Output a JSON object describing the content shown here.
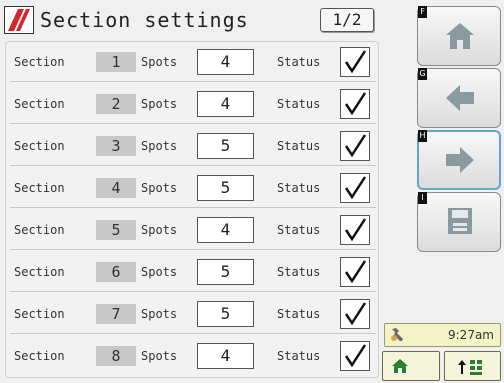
{
  "header": {
    "title": "Section settings",
    "page_indicator": "1/2"
  },
  "labels": {
    "section": "Section",
    "spots": "Spots",
    "status": "Status"
  },
  "rows": [
    {
      "section": "1",
      "spots": "4",
      "status_checked": true
    },
    {
      "section": "2",
      "spots": "4",
      "status_checked": true
    },
    {
      "section": "3",
      "spots": "5",
      "status_checked": true
    },
    {
      "section": "4",
      "spots": "5",
      "status_checked": true
    },
    {
      "section": "5",
      "spots": "4",
      "status_checked": true
    },
    {
      "section": "6",
      "spots": "5",
      "status_checked": true
    },
    {
      "section": "7",
      "spots": "5",
      "status_checked": true
    },
    {
      "section": "8",
      "spots": "4",
      "status_checked": true
    }
  ],
  "softkeys": [
    {
      "key": "F",
      "icon": "home-icon"
    },
    {
      "key": "G",
      "icon": "arrow-left-icon"
    },
    {
      "key": "H",
      "icon": "arrow-right-icon"
    },
    {
      "key": "I",
      "icon": "save-icon"
    }
  ],
  "status_bar": {
    "time": "9:27am",
    "icon": "wrench-icon"
  },
  "bottom_buttons": [
    {
      "icon": "home-icon"
    },
    {
      "icon": "up-grid-icon"
    }
  ],
  "colors": {
    "logo_red": "#d8232a",
    "nav_arrow": "#8a9aa0",
    "clock_bg": "#f3f3c8",
    "active_border": "#5fa8c9"
  }
}
